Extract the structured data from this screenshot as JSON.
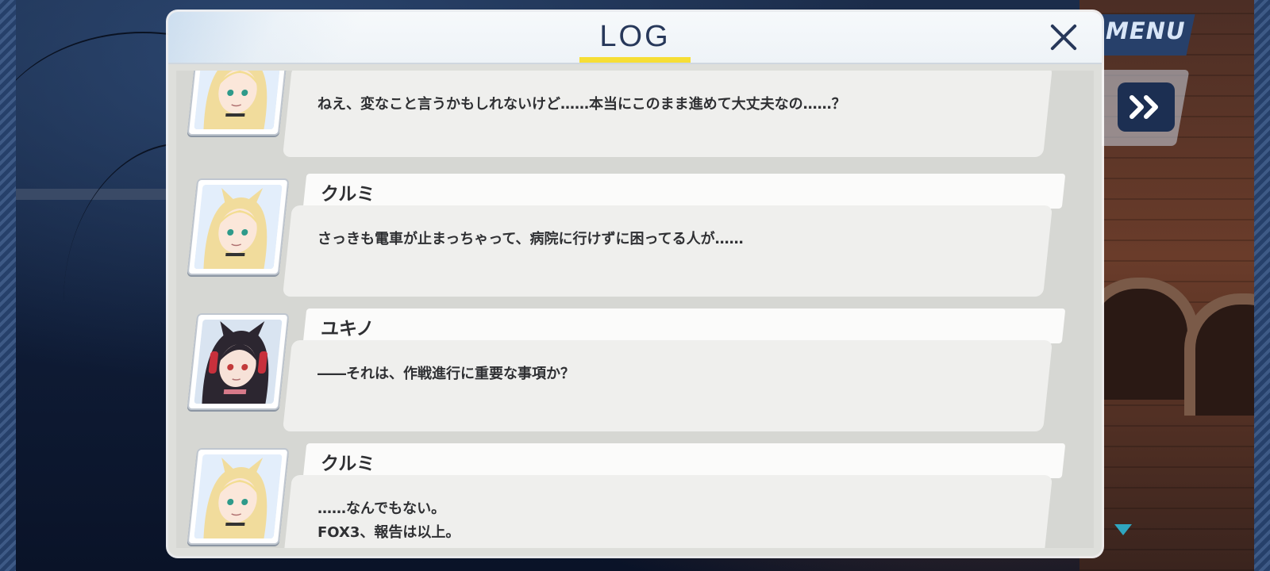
{
  "background": {
    "menu_label": "MENU",
    "fast_forward_icon": "double-chevron-right-icon"
  },
  "dialog": {
    "title": "LOG",
    "close_icon": "close-x-icon",
    "title_accent_color": "#f6de35",
    "title_color": "#27385a"
  },
  "entries": [
    {
      "speaker": "",
      "portrait": "kurumi-portrait",
      "lines": [
        "ねえ、変なこと言うかもしれないけど……本当にこのまま進めて大丈夫なの……？"
      ]
    },
    {
      "speaker": "クルミ",
      "portrait": "kurumi-portrait",
      "lines": [
        "さっきも電車が止まっちゃって、病院に行けずに困ってる人が……"
      ]
    },
    {
      "speaker": "ユキノ",
      "portrait": "yukino-portrait",
      "lines": [
        "――それは、作戦進行に重要な事項か？"
      ]
    },
    {
      "speaker": "クルミ",
      "portrait": "kurumi-portrait",
      "lines": [
        "……なんでもない。",
        "FOX3、報告は以上。"
      ]
    }
  ],
  "scroll_down_indicator": "triangle-down-icon"
}
